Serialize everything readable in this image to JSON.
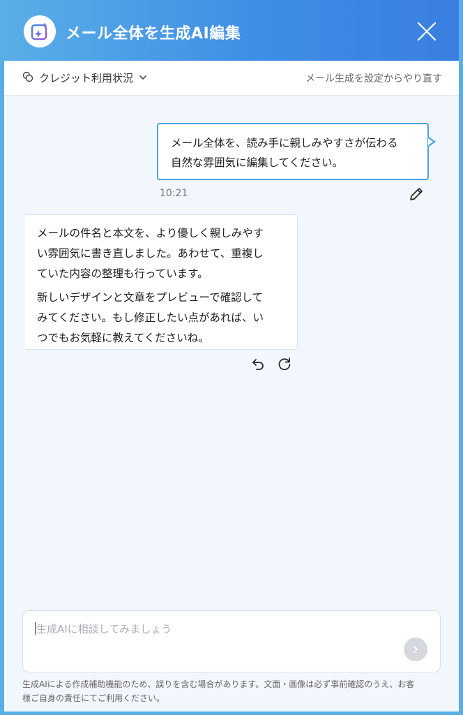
{
  "header": {
    "title": "メール全体を生成AI編集"
  },
  "subbar": {
    "credit_label": "クレジット利用状況",
    "regenerate_label": "メール生成を設定からやり直す"
  },
  "chat": {
    "user_message": {
      "line1": "メール全体を、読み手に親しみやすさが伝わる",
      "line2": "自然な雰囲気に編集してください。",
      "time": "10:21"
    },
    "ai_message": {
      "para1_line1": "メールの件名と本文を、より優しく親しみやす",
      "para1_line2": "い雰囲気に書き直しました。あわせて、重複し",
      "para1_line3": "ていた内容の整理も行っています。",
      "para2_line1": "新しいデザインと文章をプレビューで確認して",
      "para2_line2": "みてください。もし修正したい点があれば、い",
      "para2_line3": "つでもお気軽に教えてくださいね。"
    }
  },
  "input": {
    "placeholder": "生成AIに相談してみましょう"
  },
  "footer": {
    "disclaimer_line1": "生成AIによる作成補助機能のため、誤りを含む場合があります。文面・画像は必ず事前確認のうえ、お客",
    "disclaimer_line2": "様ご自身の責任にてご利用ください。"
  },
  "colors": {
    "header_start": "#5aaee6",
    "header_end": "#3a7fe0",
    "accent": "#4aa3de",
    "background": "#f2f6fd"
  },
  "icons": [
    "ai-sparkle-icon",
    "close-icon",
    "credit-coins-icon",
    "chevron-down-icon",
    "pencil-icon",
    "undo-icon",
    "refresh-icon",
    "send-arrow-icon"
  ]
}
